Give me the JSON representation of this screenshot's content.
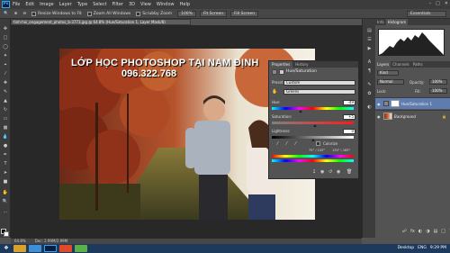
{
  "app": {
    "logo": "Ps"
  },
  "menu": [
    "File",
    "Edit",
    "Image",
    "Layer",
    "Type",
    "Select",
    "Filter",
    "3D",
    "View",
    "Window",
    "Help"
  ],
  "window_controls": [
    "–",
    "□",
    "✕"
  ],
  "options": {
    "resize_windows": "Resize Windows to Fit",
    "zoom_all": "Zoom All Windows",
    "scrubby": "Scrubby Zoom",
    "zoom_value": "100%",
    "fit_screen": "Fit Screen",
    "fill_screen": "Fill Screen",
    "workspace": "Essentials"
  },
  "document": {
    "tab": "tinh-hoi_engagement_photos_b-3773.jpg @ 64.8% (Hue/Saturation 1, Layer Mask/8)",
    "watermark_line1": "LỚP HỌC PHOTOSHOP TẠI NAM ĐỊNH",
    "watermark_line2": "096.322.768"
  },
  "status": {
    "zoom": "64.8%",
    "doc": "Doc: 2.99M/2.99M"
  },
  "properties": {
    "tabs": [
      "Properties",
      "History"
    ],
    "title": "Hue/Saturation",
    "preset_label": "Preset:",
    "preset_value": "Custom",
    "channel_value": "Greens",
    "hue_label": "Hue:",
    "hue_value": "-49",
    "hue_pos": 0.35,
    "sat_label": "Saturation:",
    "sat_value": "+5",
    "sat_pos": 0.53,
    "light_label": "Lightness:",
    "light_value": "0",
    "light_pos": 0.5,
    "colorize_label": "Colorize",
    "range_left": "75° / 105°",
    "range_right": "135° \\ 165°"
  },
  "right_panels": {
    "top_tabs": [
      "Info",
      "Histogram"
    ],
    "layer_tabs": [
      "Layers",
      "Channels",
      "Paths"
    ],
    "kind_label": "Kind",
    "blend_mode": "Normal",
    "opacity_label": "Opacity:",
    "opacity_value": "100%",
    "lock_label": "Lock:",
    "fill_label": "Fill:",
    "fill_value": "100%",
    "layers": [
      {
        "name": "Hue/Saturation 1",
        "selected": true
      },
      {
        "name": "Background",
        "selected": false
      }
    ]
  },
  "taskbar": {
    "tray_text": "Desktop",
    "lang": "ENG",
    "time": "9:29 PM"
  }
}
